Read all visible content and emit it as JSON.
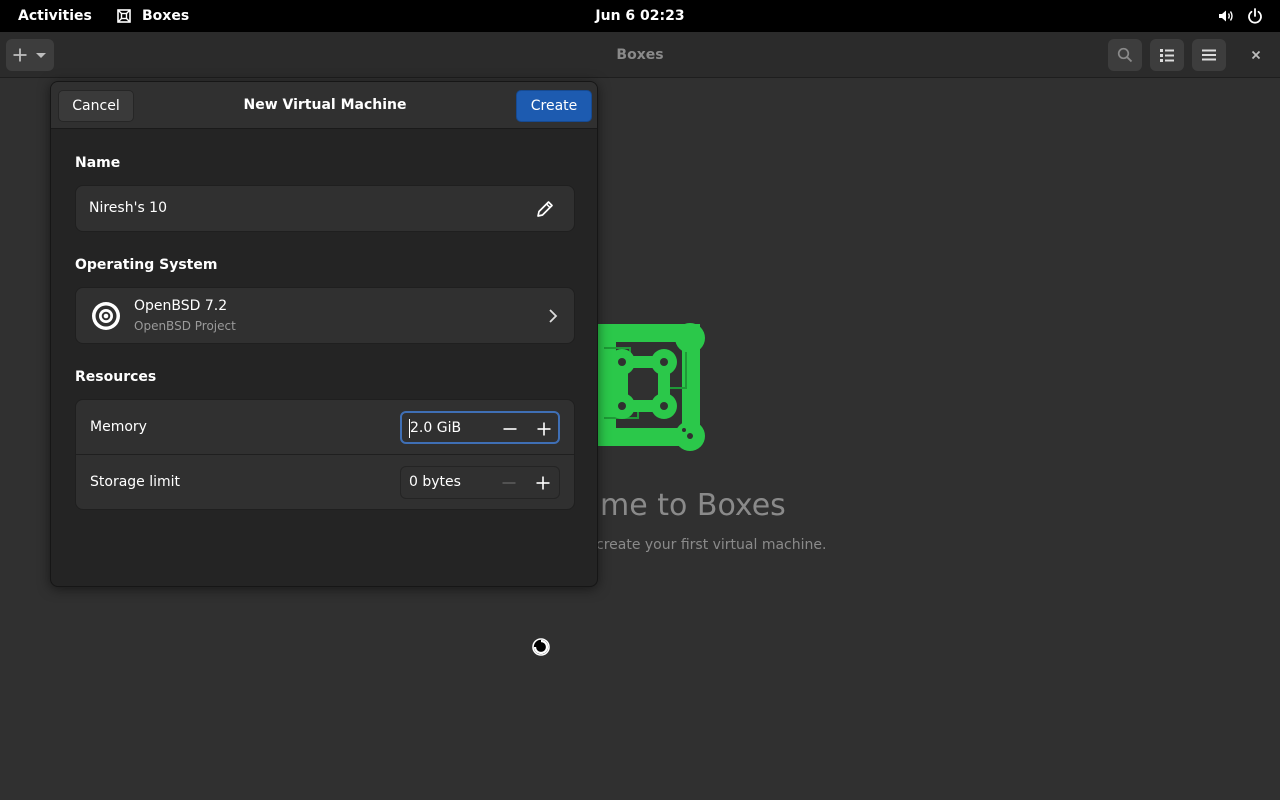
{
  "topbar": {
    "activities": "Activities",
    "app_name": "Boxes",
    "clock": "Jun 6  02:23",
    "icons": [
      "boxes-app-icon",
      "volume-icon",
      "power-icon"
    ]
  },
  "headerbar": {
    "title": "Boxes",
    "icons": [
      "plus-icon",
      "dropdown-arrow-icon",
      "search-icon",
      "list-view-icon",
      "hamburger-menu-icon",
      "close-icon"
    ]
  },
  "welcome": {
    "title": "me to Boxes",
    "subtitle": "create your first virtual machine."
  },
  "dialog": {
    "cancel_label": "Cancel",
    "title": "New Virtual Machine",
    "create_label": "Create",
    "name_section": {
      "label": "Name",
      "value": "Niresh's 10"
    },
    "os_section": {
      "label": "Operating System",
      "os_name": "OpenBSD 7.2",
      "vendor": "OpenBSD Project"
    },
    "resources_section": {
      "label": "Resources",
      "memory_label": "Memory",
      "memory_value": "2.0 GiB",
      "storage_label": "Storage limit",
      "storage_value": "0 bytes"
    }
  },
  "colors": {
    "accent": "#1d5bb0",
    "focus_ring": "#3f6fb5",
    "logo_green": "#2bc84a",
    "background": "#303030"
  }
}
